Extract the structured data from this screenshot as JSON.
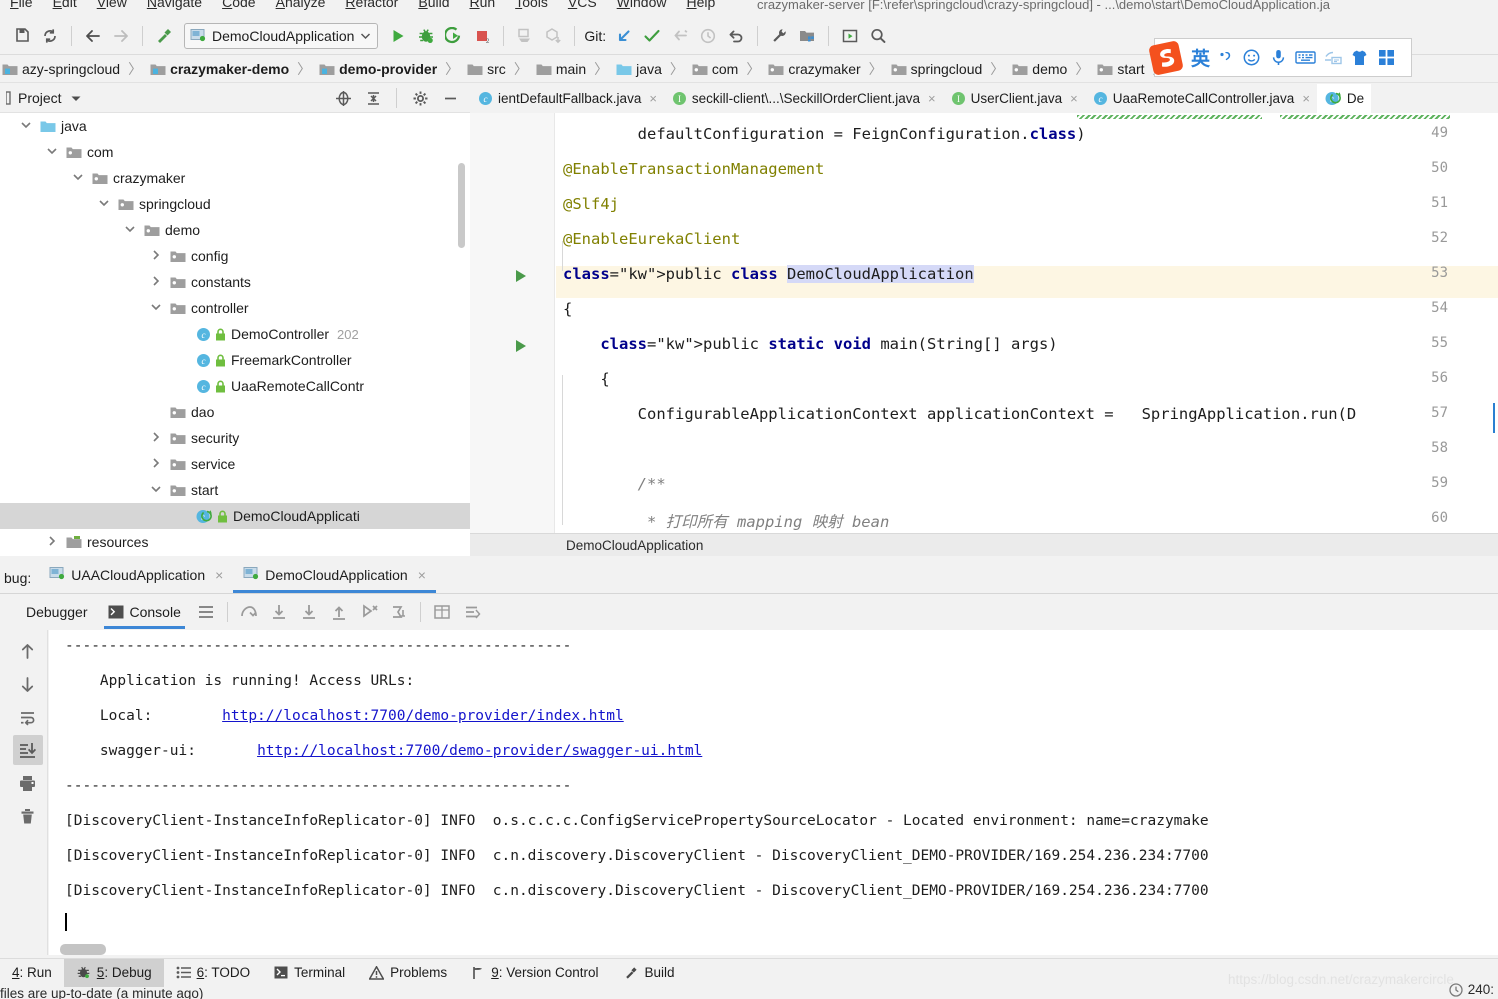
{
  "window": {
    "title": "crazymaker-server [F:\\refer\\springcloud\\crazy-springcloud] - ...\\demo\\start\\DemoCloudApplication.ja"
  },
  "menubar": {
    "items": [
      "File",
      "Edit",
      "View",
      "Navigate",
      "Code",
      "Analyze",
      "Refactor",
      "Build",
      "Run",
      "Tools",
      "VCS",
      "Window",
      "Help"
    ]
  },
  "toolbar": {
    "run_config": "DemoCloudApplication",
    "git_label": "Git:",
    "icons": [
      "save-all-icon",
      "sync-icon",
      "back-icon",
      "forward-icon",
      "build-hammer-icon",
      "run-icon",
      "debug-icon",
      "run-coverage-icon",
      "stop-icon",
      "attach-profiler-icon",
      "update-project-icon",
      "git-update-icon",
      "git-commit-icon",
      "git-push-icon",
      "git-history-icon",
      "git-rollback-icon",
      "settings-wrench-icon",
      "project-structure-icon",
      "run-anything-icon",
      "search-everywhere-icon"
    ]
  },
  "breadcrumbs": {
    "items": [
      {
        "label": "azy-springcloud",
        "icon": "module-icon",
        "bold": false
      },
      {
        "label": "crazymaker-demo",
        "icon": "module-icon",
        "bold": true
      },
      {
        "label": "demo-provider",
        "icon": "module-icon",
        "bold": true
      },
      {
        "label": "src",
        "icon": "folder-icon",
        "bold": false
      },
      {
        "label": "main",
        "icon": "folder-icon",
        "bold": false
      },
      {
        "label": "java",
        "icon": "source-folder-icon",
        "bold": false
      },
      {
        "label": "com",
        "icon": "package-icon",
        "bold": false
      },
      {
        "label": "crazymaker",
        "icon": "package-icon",
        "bold": false
      },
      {
        "label": "springcloud",
        "icon": "package-icon",
        "bold": false
      },
      {
        "label": "demo",
        "icon": "package-icon",
        "bold": false
      },
      {
        "label": "start",
        "icon": "package-icon",
        "bold": false
      },
      {
        "label": "DemoCloudApplication",
        "icon": "java-class-icon",
        "bold": false
      }
    ]
  },
  "project_panel": {
    "title": "Project",
    "header_icons": [
      "locate-icon",
      "collapse-all-icon",
      "gear-icon",
      "hide-icon"
    ],
    "tree": [
      {
        "label": "java",
        "indent": 4,
        "icon": "source-folder-icon",
        "twisty": "open",
        "extra": "",
        "selected": false
      },
      {
        "label": "com",
        "indent": 5,
        "icon": "package-icon",
        "twisty": "open",
        "extra": "",
        "selected": false
      },
      {
        "label": "crazymaker",
        "indent": 6,
        "icon": "package-icon",
        "twisty": "open",
        "extra": "",
        "selected": false
      },
      {
        "label": "springcloud",
        "indent": 7,
        "icon": "package-icon",
        "twisty": "open",
        "extra": "",
        "selected": false
      },
      {
        "label": "demo",
        "indent": 8,
        "icon": "package-icon",
        "twisty": "open",
        "extra": "",
        "selected": false
      },
      {
        "label": "config",
        "indent": 9,
        "icon": "package-icon",
        "twisty": "closed",
        "extra": "",
        "selected": false
      },
      {
        "label": "constants",
        "indent": 9,
        "icon": "package-icon",
        "twisty": "closed",
        "extra": "",
        "selected": false
      },
      {
        "label": "controller",
        "indent": 9,
        "icon": "package-icon",
        "twisty": "open",
        "extra": "",
        "selected": false
      },
      {
        "label": "DemoController",
        "indent": 10,
        "icon": "java-class-icon",
        "twisty": "none",
        "extra": "202",
        "selected": false
      },
      {
        "label": "FreemarkController",
        "indent": 10,
        "icon": "java-class-icon",
        "twisty": "none",
        "extra": "",
        "selected": false
      },
      {
        "label": "UaaRemoteCallContr",
        "indent": 10,
        "icon": "java-class-icon",
        "twisty": "none",
        "extra": "",
        "selected": false
      },
      {
        "label": "dao",
        "indent": 9,
        "icon": "package-icon",
        "twisty": "none",
        "extra": "",
        "selected": false
      },
      {
        "label": "security",
        "indent": 9,
        "icon": "package-icon",
        "twisty": "closed",
        "extra": "",
        "selected": false
      },
      {
        "label": "service",
        "indent": 9,
        "icon": "package-icon",
        "twisty": "closed",
        "extra": "",
        "selected": false
      },
      {
        "label": "start",
        "indent": 9,
        "icon": "package-icon",
        "twisty": "open",
        "extra": "",
        "selected": false
      },
      {
        "label": "DemoCloudApplicati",
        "indent": 10,
        "icon": "java-runnable-class-icon",
        "twisty": "none",
        "extra": "",
        "selected": true
      },
      {
        "label": "resources",
        "indent": 5,
        "icon": "resource-folder-icon",
        "twisty": "closed",
        "extra": "",
        "selected": false
      }
    ]
  },
  "editor_tabs": [
    {
      "label": "ientDefaultFallback.java",
      "icon": "java-class-icon",
      "active": false
    },
    {
      "label": "seckill-client\\...\\SeckillOrderClient.java",
      "icon": "java-interface-icon",
      "active": false
    },
    {
      "label": "UserClient.java",
      "icon": "java-interface-icon",
      "active": false
    },
    {
      "label": "UaaRemoteCallController.java",
      "icon": "java-class-icon",
      "active": false
    },
    {
      "label": "De",
      "icon": "java-runnable-class-icon",
      "active": true
    }
  ],
  "editor": {
    "lines": [
      {
        "num": "49",
        "text": "        defaultConfiguration = FeignConfiguration.class)",
        "runnable": false
      },
      {
        "num": "50",
        "text": "@EnableTransactionManagement",
        "runnable": false
      },
      {
        "num": "51",
        "text": "@Slf4j",
        "runnable": false
      },
      {
        "num": "52",
        "text": "@EnableEurekaClient",
        "runnable": false
      },
      {
        "num": "53",
        "text": "public class DemoCloudApplication",
        "runnable": true
      },
      {
        "num": "54",
        "text": "{",
        "runnable": false
      },
      {
        "num": "55",
        "text": "    public static void main(String[] args)",
        "runnable": true
      },
      {
        "num": "56",
        "text": "    {",
        "runnable": false
      },
      {
        "num": "57",
        "text": "        ConfigurableApplicationContext applicationContext =   SpringApplication.run(D",
        "runnable": false
      },
      {
        "num": "58",
        "text": "",
        "runnable": false
      },
      {
        "num": "59",
        "text": "        /**",
        "runnable": false
      },
      {
        "num": "60",
        "text": "         * 打印所有 mapping 映射 bean",
        "runnable": false
      }
    ],
    "selected_token": "DemoCloudApplication",
    "breadcrumb_status": "DemoCloudApplication"
  },
  "debug_panel": {
    "label": "bug:",
    "session_tabs": [
      {
        "label": "UAACloudApplication",
        "active": false
      },
      {
        "label": "DemoCloudApplication",
        "active": true
      }
    ],
    "sub_tabs": [
      {
        "label": "Debugger",
        "icon": "",
        "active": false
      },
      {
        "label": "Console",
        "icon": "console-icon",
        "active": true
      }
    ],
    "toolbar_icons": [
      "layout-settings-icon",
      "step-over-icon",
      "step-into-icon",
      "force-step-into-icon",
      "step-out-icon",
      "run-to-cursor-icon",
      "evaluate-icon",
      "watches-table-icon",
      "mute-breakpoints-icon"
    ],
    "side_icons": [
      "up-arrow-icon",
      "down-arrow-icon",
      "soft-wrap-icon",
      "scroll-to-end-icon",
      "print-icon",
      "trash-icon"
    ],
    "console_lines": [
      {
        "text": "----------------------------------------------------------",
        "type": "plain"
      },
      {
        "text": "Application is running! Access URLs:",
        "type": "plain",
        "indent": 40
      },
      {
        "text": "Local:        ",
        "type": "plain",
        "indent": 40,
        "link": "http://localhost:7700/demo-provider/index.html"
      },
      {
        "text": "swagger-ui:       ",
        "type": "plain",
        "indent": 40,
        "link": "http://localhost:7700/demo-provider/swagger-ui.html"
      },
      {
        "text": "----------------------------------------------------------",
        "type": "plain"
      },
      {
        "text": "[DiscoveryClient-InstanceInfoReplicator-0] INFO  o.s.c.c.c.ConfigServicePropertySourceLocator - Located environment: name=crazymake",
        "type": "plain"
      },
      {
        "text": "[DiscoveryClient-InstanceInfoReplicator-0] INFO  c.n.discovery.DiscoveryClient - DiscoveryClient_DEMO-PROVIDER/169.254.236.234:7700",
        "type": "plain"
      },
      {
        "text": "[DiscoveryClient-InstanceInfoReplicator-0] INFO  c.n.discovery.DiscoveryClient - DiscoveryClient_DEMO-PROVIDER/169.254.236.234:7700",
        "type": "plain"
      }
    ]
  },
  "statusbar": {
    "items": [
      {
        "label": "4: Run",
        "accesskey": "4",
        "icon": "",
        "active": false
      },
      {
        "label": "5: Debug",
        "accesskey": "5",
        "icon": "debug-icon",
        "active": true
      },
      {
        "label": "6: TODO",
        "accesskey": "6",
        "icon": "todo-icon",
        "active": false
      },
      {
        "label": "Terminal",
        "accesskey": "",
        "icon": "terminal-icon",
        "active": false
      },
      {
        "label": "Problems",
        "accesskey": "",
        "icon": "warning-icon",
        "active": false
      },
      {
        "label": "9: Version Control",
        "accesskey": "9",
        "icon": "branch-icon",
        "active": false
      },
      {
        "label": "Build",
        "accesskey": "",
        "icon": "hammer-icon",
        "active": false
      }
    ],
    "message": "files are up-to-date (a minute ago)",
    "right_value": "240:",
    "watermark": "https://blog.csdn.net/crazymakercircle"
  },
  "ime": {
    "logo": "S",
    "mode_label": "英",
    "buttons": [
      "punctuation-icon",
      "emoji-icon",
      "voice-input-icon",
      "soft-keyboard-icon",
      "handwriting-icon",
      "skin-icon",
      "toolbox-icon"
    ]
  },
  "colors": {
    "accent": "#3d87d6",
    "link": "#1414cc",
    "run_green": "#4a9a4a",
    "ime_blue": "#2b80d8",
    "selection": "#d5d9f7",
    "highlight_row": "#fdf6e3"
  }
}
